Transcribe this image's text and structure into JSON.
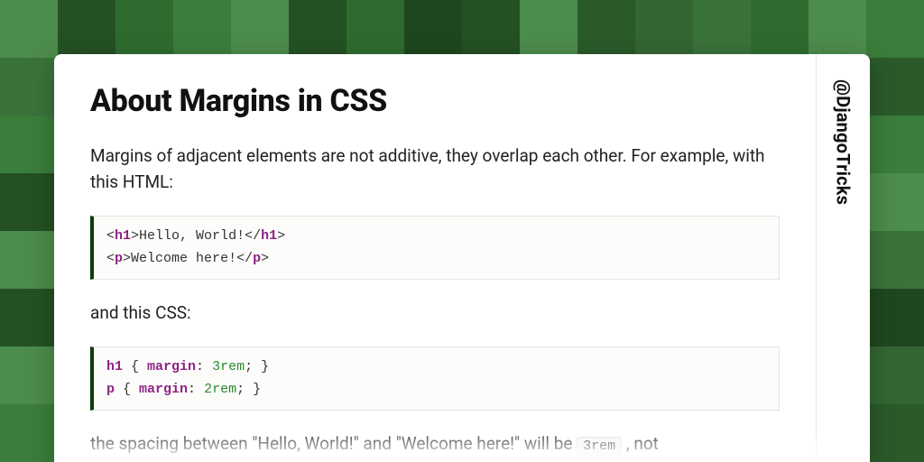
{
  "title": "About Margins in CSS",
  "intro": "Margins of adjacent elements are not additive, they overlap each other. For example, with this HTML:",
  "code_html": {
    "line1": {
      "tag": "h1",
      "text": "Hello, World!"
    },
    "line2": {
      "tag": "p",
      "text": "Welcome here!"
    }
  },
  "mid_text": "and this CSS:",
  "code_css": {
    "line1": {
      "selector": "h1",
      "prop": "margin",
      "value": "3rem"
    },
    "line2": {
      "selector": "p",
      "prop": "margin",
      "value": "2rem"
    }
  },
  "outro_pre": "the spacing between \"Hello, World!\" and \"Welcome here!\" will be ",
  "outro_code": "3rem",
  "outro_post": " , not",
  "handle": "@DjangoTricks",
  "bg_palette": [
    "#2f6b2f",
    "#3b7d3b",
    "#2a5a2a",
    "#4c8c4c",
    "#245124",
    "#3a733a",
    "#336633",
    "#1f471f"
  ]
}
